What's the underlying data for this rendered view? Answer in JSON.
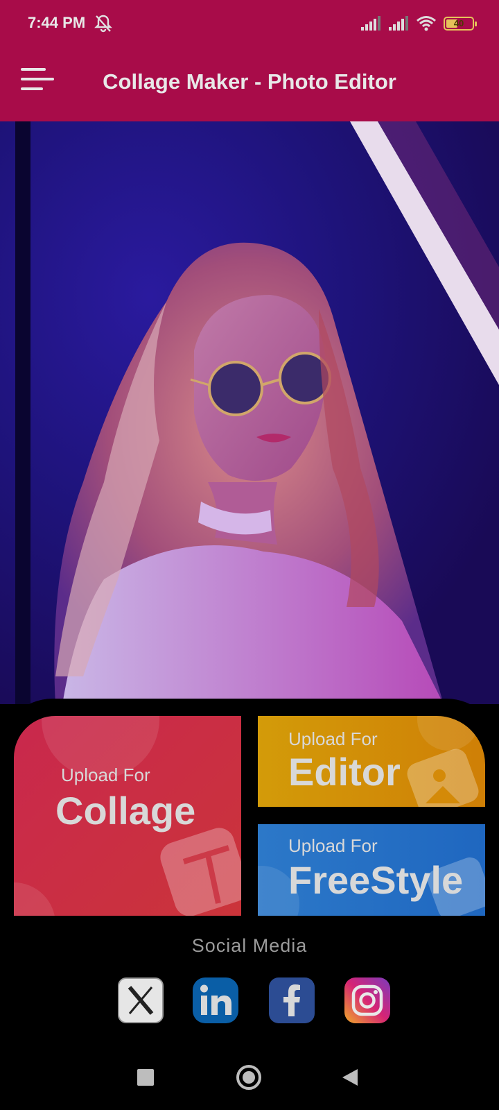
{
  "status_bar": {
    "time": "7:44 PM",
    "battery_level": "40",
    "icons": [
      "bell-off-icon",
      "signal-icon",
      "signal-icon",
      "wifi-icon",
      "battery-icon"
    ]
  },
  "app_bar": {
    "title": "Collage Maker - Photo Editor",
    "menu_icon": "hamburger-menu-icon"
  },
  "hero": {
    "description_icon": "photo-banner"
  },
  "tiles": {
    "collage": {
      "prefix": "Upload For",
      "label": "Collage"
    },
    "editor": {
      "prefix": "Upload For",
      "label": "Editor"
    },
    "freestyle": {
      "prefix": "Upload For",
      "label": "FreeStyle"
    }
  },
  "social": {
    "title": "Social Media",
    "items": [
      {
        "name": "X",
        "icon": "x-icon",
        "color": "#e8e8e8"
      },
      {
        "name": "LinkedIn",
        "icon": "linkedin-icon",
        "color": "#0a5ea6"
      },
      {
        "name": "Facebook",
        "icon": "facebook-icon",
        "color": "#2c4c93"
      },
      {
        "name": "Instagram",
        "icon": "instagram-icon",
        "color": "#d6248a"
      }
    ]
  },
  "colors": {
    "brand": "#a80c49",
    "collage_tile": "#cb2c45",
    "editor_tile": "#d28e08",
    "freestyle_tile": "#2670c4"
  }
}
